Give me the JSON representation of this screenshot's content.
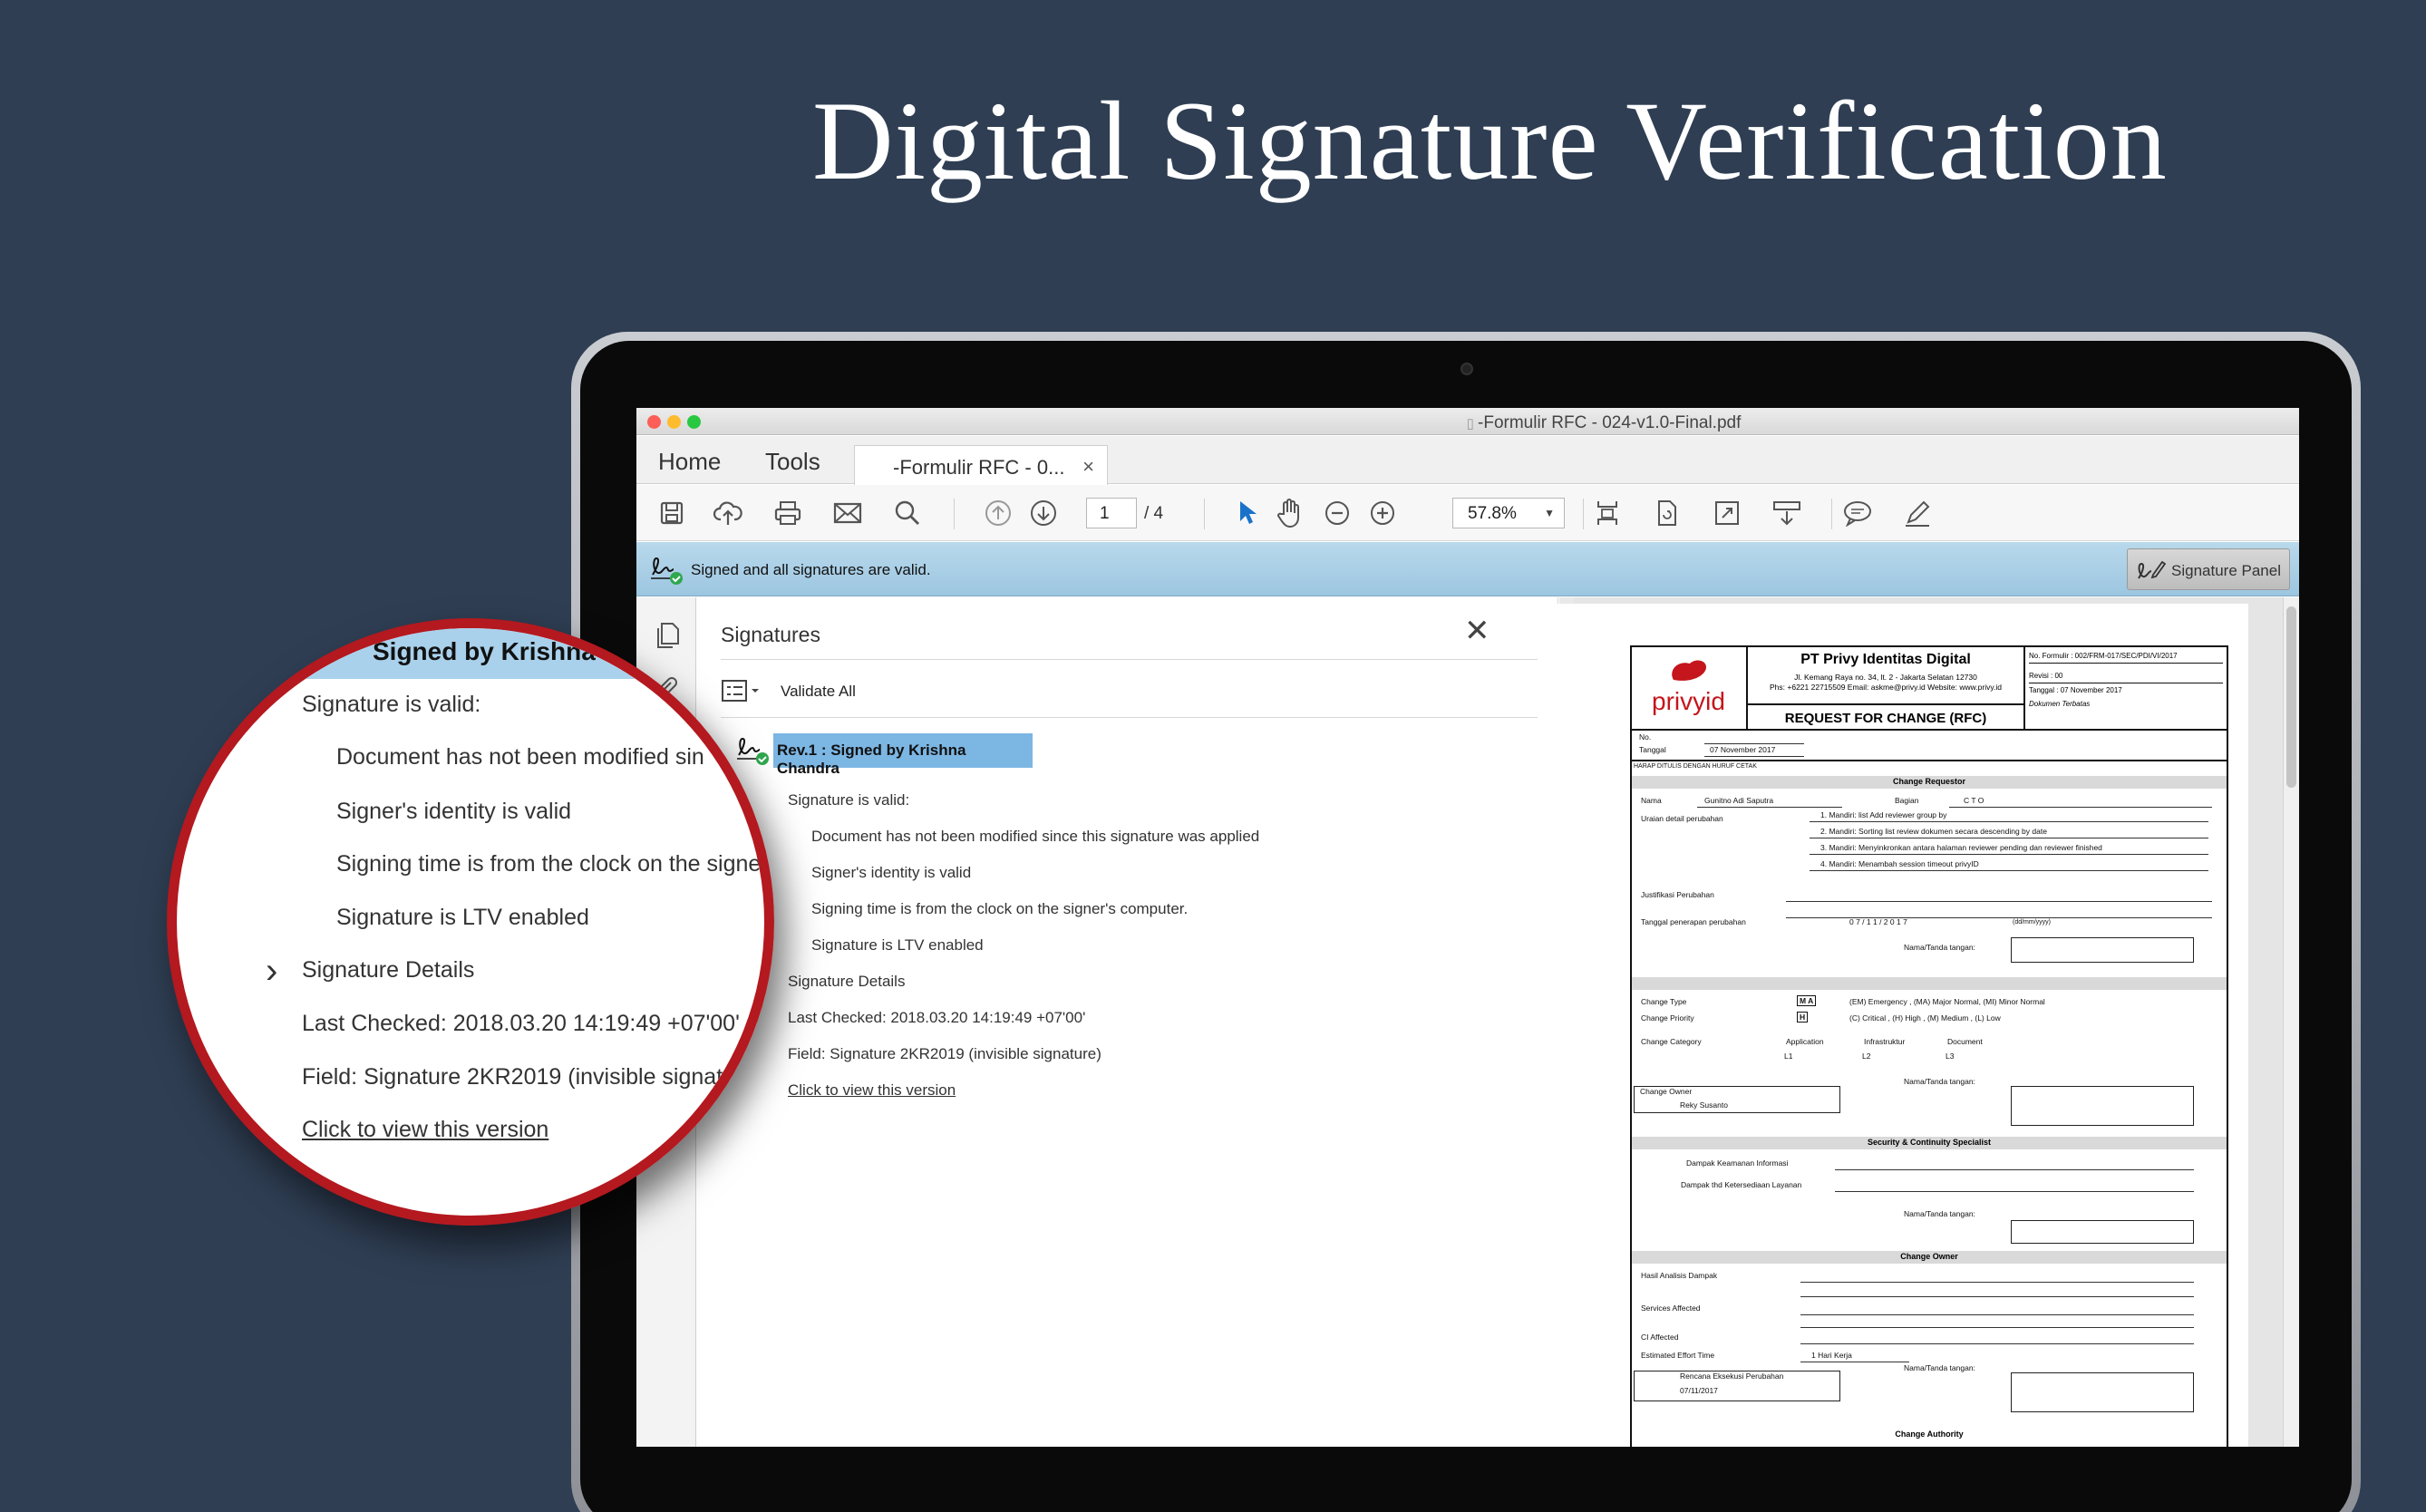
{
  "hero": {
    "title": "Digital Signature Verification"
  },
  "window": {
    "title": "-Formulir RFC - 024-v1.0-Final.pdf"
  },
  "nav": {
    "home": "Home",
    "tools": "Tools",
    "doc_tab": "-Formulir RFC - 0...",
    "close_glyph": "×"
  },
  "toolbar": {
    "page_current": "1",
    "page_total": "/ 4",
    "zoom": "57.8%"
  },
  "status_bar": {
    "message": "Signed and all signatures are valid.",
    "signature_panel_button": "Signature Panel"
  },
  "signatures_panel": {
    "title": "Signatures",
    "validate_all": "Validate All",
    "revision_label": "Rev.1 : Signed by Krishna Chandra",
    "valid_heading": "Signature is valid:",
    "checks": [
      "Document has not been modified since this signature was applied",
      "Signer's identity is valid",
      "Signing time is from the clock on the signer's computer.",
      "Signature is LTV enabled"
    ],
    "details_label": "Signature Details",
    "last_checked": "Last Checked: 2018.03.20 14:19:49 +07'00'",
    "field": "Field: Signature 2KR2019 (invisible signature)",
    "view_version_link": "Click to view this version"
  },
  "magnifier": {
    "header": "Signed by Krishna",
    "valid_heading": "Signature is valid:",
    "checks": [
      "Document has not been modified sin",
      "Signer's identity is valid",
      "Signing time is from the clock on the signe",
      "Signature is LTV enabled"
    ],
    "details_label": "Signature Details",
    "last_checked": "Last Checked: 2018.03.20 14:19:49 +07'00'",
    "field": "Field: Signature 2KR2019 (invisible signat",
    "view_version_link": "Click to view this version"
  },
  "document": {
    "logo": "privyid",
    "company": "PT Privy Identitas Digital",
    "address_1": "Jl. Kemang Raya no. 34, lt. 2 - Jakarta Selatan 12730",
    "address_2": "Phs: +6221 22715509 Email: askme@privy.id Website: www.privy.id",
    "form_title": "REQUEST FOR CHANGE (RFC)",
    "form_number": "No. Formulir : 002/FRM-017/SEC/PDI/VI/2017",
    "revision": "Revisi : 00",
    "date_meta": "Tanggal : 07 November 2017",
    "classification": "Dokumen Terbatas",
    "no_label": "No.",
    "tanggal_label": "Tanggal",
    "tanggal_value": "07 November 2017",
    "print_note": "HARAP DITULIS DENGAN HURUF CETAK",
    "sections": {
      "requestor": "Change Requestor",
      "security": "Security & Continuity Specialist",
      "owner": "Change Owner",
      "authority": "Change Authority"
    },
    "nama_label": "Nama",
    "nama_value": "Gunitno Adi Saputra",
    "bagian_label": "Bagian",
    "bagian_value": "C T O",
    "uraian_label": "Uraian detail perubahan",
    "uraian_items": [
      "1. Mandiri: list Add reviewer group by",
      "2. Mandiri: Sorting list review dokumen secara descending by date",
      "3. Mandiri: Menyinkronkan antara halaman reviewer pending dan reviewer finished",
      "4. Mandiri: Menambah session timeout privyID"
    ],
    "justifikasi_label": "Justifikasi Perubahan",
    "tanggal_penerapan_label": "Tanggal penerapan perubahan",
    "tanggal_penerapan_value": "0 7 /  1 1 /    2 0 1 7",
    "date_format": "(dd/mm/yyyy)",
    "nama_ttd_label": "Nama/Tanda tangan:",
    "change_type_label": "Change Type",
    "change_type_marks": "M A",
    "change_type_options": "(EM) Emergency , (MA) Major Normal, (MI) Minor Normal",
    "change_priority_label": "Change Priority",
    "change_priority_mark": "H",
    "change_priority_options": "(C) Critical , (H) High , (M) Medium , (L) Low",
    "change_category_label": "Change Category",
    "categories": [
      "Application",
      "Infrastruktur",
      "Document"
    ],
    "category_codes": [
      "L1",
      "L2",
      "L3"
    ],
    "change_owner_label": "Change Owner",
    "change_owner_value": "Reky Susanto",
    "dampak_keamanan_label": "Dampak Keamanan Informasi",
    "dampak_ketersediaan_label": "Dampak thd Ketersediaan Layanan",
    "hasil_analisis_label": "Hasil Analisis Dampak",
    "services_affected_label": "Services Affected",
    "ci_affected_label": "CI Affected",
    "estimated_effort_label": "Estimated Effort Time",
    "estimated_effort_value": "1 Hari Kerja",
    "rencana_label": "Rencana Eksekusi Perubahan",
    "rencana_value": "07/11/2017",
    "colon": ":"
  },
  "colors": {
    "background": "#2f3e53",
    "accent_red": "#b3191f",
    "status_bar": "#a9d1ec",
    "selection": "#7cb6e3"
  }
}
